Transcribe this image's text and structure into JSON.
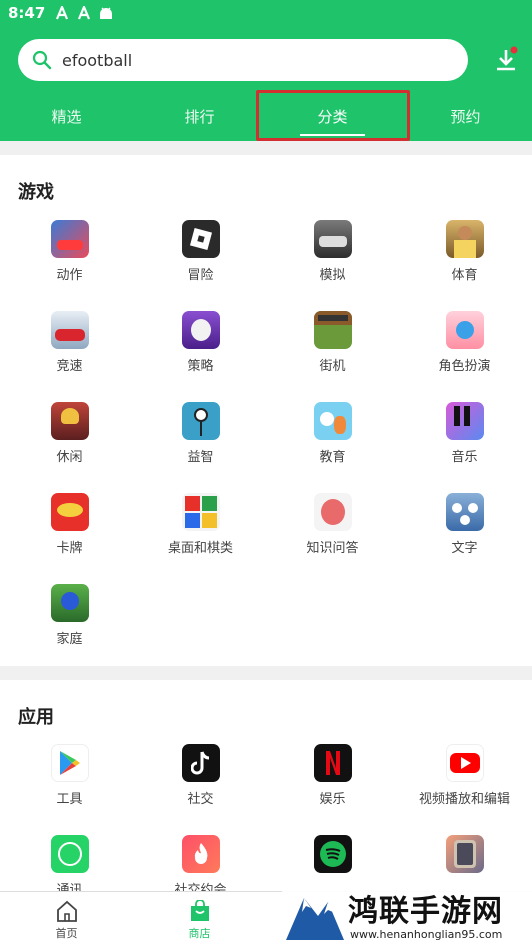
{
  "status_bar": {
    "time": "8:47"
  },
  "search": {
    "value": "efootball"
  },
  "tabs": [
    {
      "label": "精选",
      "active": false
    },
    {
      "label": "排行",
      "active": false
    },
    {
      "label": "分类",
      "active": true
    },
    {
      "label": "预约",
      "active": false
    }
  ],
  "games": {
    "title": "游戏",
    "items": [
      {
        "label": "动作",
        "icon": "action-icon"
      },
      {
        "label": "冒险",
        "icon": "adventure-icon"
      },
      {
        "label": "模拟",
        "icon": "simulation-icon"
      },
      {
        "label": "体育",
        "icon": "sports-icon"
      },
      {
        "label": "竞速",
        "icon": "racing-icon"
      },
      {
        "label": "策略",
        "icon": "strategy-icon"
      },
      {
        "label": "街机",
        "icon": "arcade-icon"
      },
      {
        "label": "角色扮演",
        "icon": "rpg-icon"
      },
      {
        "label": "休闲",
        "icon": "casual-icon"
      },
      {
        "label": "益智",
        "icon": "puzzle-icon"
      },
      {
        "label": "教育",
        "icon": "education-icon"
      },
      {
        "label": "音乐",
        "icon": "music-icon"
      },
      {
        "label": "卡牌",
        "icon": "card-icon"
      },
      {
        "label": "桌面和棋类",
        "icon": "board-icon"
      },
      {
        "label": "知识问答",
        "icon": "trivia-icon"
      },
      {
        "label": "文字",
        "icon": "word-icon"
      },
      {
        "label": "家庭",
        "icon": "family-icon"
      }
    ]
  },
  "apps": {
    "title": "应用",
    "items": [
      {
        "label": "工具",
        "icon": "play-store-icon"
      },
      {
        "label": "社交",
        "icon": "tiktok-icon"
      },
      {
        "label": "娱乐",
        "icon": "netflix-icon"
      },
      {
        "label": "视频播放和编辑",
        "icon": "youtube-icon"
      },
      {
        "label": "通讯",
        "icon": "whatsapp-icon"
      },
      {
        "label": "社交约会",
        "icon": "tinder-icon"
      },
      {
        "label": "",
        "icon": "spotify-icon"
      },
      {
        "label": "",
        "icon": "phone-icon"
      }
    ]
  },
  "bottom_nav": [
    {
      "label": "首页",
      "icon": "home-icon",
      "active": false
    },
    {
      "label": "商店",
      "icon": "store-icon",
      "active": true
    }
  ],
  "watermark": {
    "title": "鸿联手游网",
    "url": "www.henanhonglian95.com"
  },
  "colors": {
    "brand": "#1ec36a",
    "highlight": "#d23030"
  }
}
